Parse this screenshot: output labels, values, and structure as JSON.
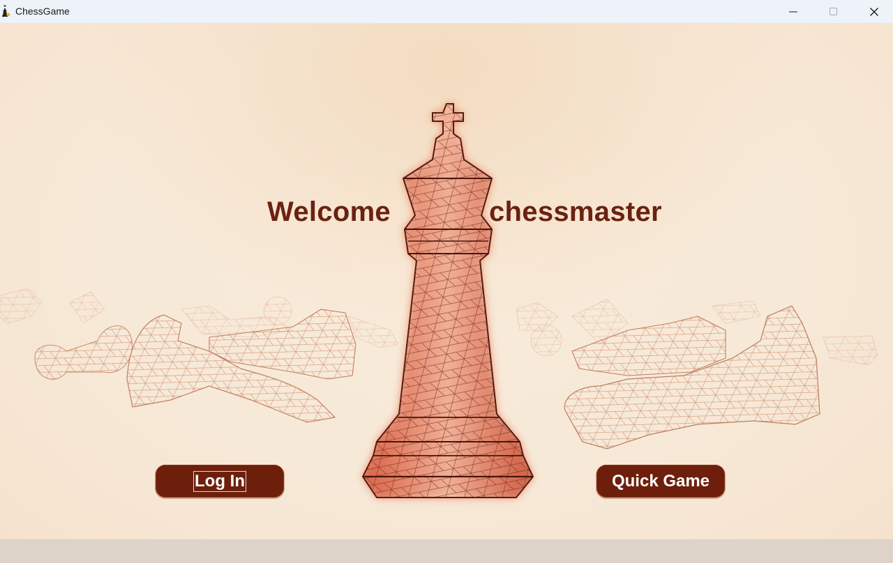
{
  "window": {
    "title": "ChessGame",
    "icon": "chess-king-icon",
    "controls": [
      "minimize-icon",
      "maximize-icon",
      "close-icon"
    ]
  },
  "hero": {
    "welcome_left": "Welcome",
    "welcome_right": "chessmaster",
    "text_color": "#6b2210"
  },
  "buttons": {
    "login_label": "Log In",
    "quick_game_label": "Quick Game",
    "color": "#6d1f0c"
  },
  "colors": {
    "background": "#f7e9d8",
    "accent": "#e0502a"
  }
}
